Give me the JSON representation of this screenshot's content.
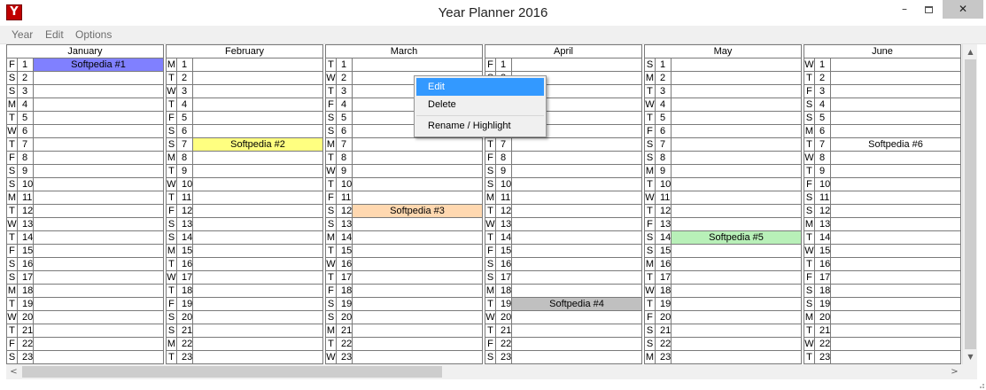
{
  "window": {
    "title": "Year Planner 2016",
    "app_icon_glyph": "Y",
    "minimize_glyph": "–",
    "close_glyph": "✕"
  },
  "menubar": {
    "items": [
      "Year",
      "Edit",
      "Options"
    ]
  },
  "months": [
    {
      "name": "January",
      "days": [
        [
          "F",
          "1"
        ],
        [
          "S",
          "2"
        ],
        [
          "S",
          "3"
        ],
        [
          "M",
          "4"
        ],
        [
          "T",
          "5"
        ],
        [
          "W",
          "6"
        ],
        [
          "T",
          "7"
        ],
        [
          "F",
          "8"
        ],
        [
          "S",
          "9"
        ],
        [
          "S",
          "10"
        ],
        [
          "M",
          "11"
        ],
        [
          "T",
          "12"
        ],
        [
          "W",
          "13"
        ],
        [
          "T",
          "14"
        ],
        [
          "F",
          "15"
        ],
        [
          "S",
          "16"
        ],
        [
          "S",
          "17"
        ],
        [
          "M",
          "18"
        ],
        [
          "T",
          "19"
        ],
        [
          "W",
          "20"
        ],
        [
          "T",
          "21"
        ],
        [
          "F",
          "22"
        ],
        [
          "S",
          "23"
        ]
      ],
      "events": [
        {
          "day": 1,
          "label": "Softpedia #1",
          "color": "#8080ff"
        }
      ]
    },
    {
      "name": "February",
      "days": [
        [
          "M",
          "1"
        ],
        [
          "T",
          "2"
        ],
        [
          "W",
          "3"
        ],
        [
          "T",
          "4"
        ],
        [
          "F",
          "5"
        ],
        [
          "S",
          "6"
        ],
        [
          "S",
          "7"
        ],
        [
          "M",
          "8"
        ],
        [
          "T",
          "9"
        ],
        [
          "W",
          "10"
        ],
        [
          "T",
          "11"
        ],
        [
          "F",
          "12"
        ],
        [
          "S",
          "13"
        ],
        [
          "S",
          "14"
        ],
        [
          "M",
          "15"
        ],
        [
          "T",
          "16"
        ],
        [
          "W",
          "17"
        ],
        [
          "T",
          "18"
        ],
        [
          "F",
          "19"
        ],
        [
          "S",
          "20"
        ],
        [
          "S",
          "21"
        ],
        [
          "M",
          "22"
        ],
        [
          "T",
          "23"
        ]
      ],
      "events": [
        {
          "day": 7,
          "label": "Softpedia #2",
          "color": "#ffff80"
        }
      ]
    },
    {
      "name": "March",
      "days": [
        [
          "T",
          "1"
        ],
        [
          "W",
          "2"
        ],
        [
          "T",
          "3"
        ],
        [
          "F",
          "4"
        ],
        [
          "S",
          "5"
        ],
        [
          "S",
          "6"
        ],
        [
          "M",
          "7"
        ],
        [
          "T",
          "8"
        ],
        [
          "W",
          "9"
        ],
        [
          "T",
          "10"
        ],
        [
          "F",
          "11"
        ],
        [
          "S",
          "12"
        ],
        [
          "S",
          "13"
        ],
        [
          "M",
          "14"
        ],
        [
          "T",
          "15"
        ],
        [
          "W",
          "16"
        ],
        [
          "T",
          "17"
        ],
        [
          "F",
          "18"
        ],
        [
          "S",
          "19"
        ],
        [
          "S",
          "20"
        ],
        [
          "M",
          "21"
        ],
        [
          "T",
          "22"
        ],
        [
          "W",
          "23"
        ]
      ],
      "events": [
        {
          "day": 12,
          "label": "Softpedia #3",
          "color": "#ffd8b0"
        }
      ]
    },
    {
      "name": "April",
      "days": [
        [
          "F",
          "1"
        ],
        [
          "S",
          "2"
        ],
        [
          "S",
          "3"
        ],
        [
          "M",
          "4"
        ],
        [
          "T",
          "5"
        ],
        [
          "W",
          "6"
        ],
        [
          "T",
          "7"
        ],
        [
          "F",
          "8"
        ],
        [
          "S",
          "9"
        ],
        [
          "S",
          "10"
        ],
        [
          "M",
          "11"
        ],
        [
          "T",
          "12"
        ],
        [
          "W",
          "13"
        ],
        [
          "T",
          "14"
        ],
        [
          "F",
          "15"
        ],
        [
          "S",
          "16"
        ],
        [
          "S",
          "17"
        ],
        [
          "M",
          "18"
        ],
        [
          "T",
          "19"
        ],
        [
          "W",
          "20"
        ],
        [
          "T",
          "21"
        ],
        [
          "F",
          "22"
        ],
        [
          "S",
          "23"
        ]
      ],
      "events": [
        {
          "day": 19,
          "label": "Softpedia #4",
          "color": "#c0c0c0"
        }
      ]
    },
    {
      "name": "May",
      "days": [
        [
          "S",
          "1"
        ],
        [
          "M",
          "2"
        ],
        [
          "T",
          "3"
        ],
        [
          "W",
          "4"
        ],
        [
          "T",
          "5"
        ],
        [
          "F",
          "6"
        ],
        [
          "S",
          "7"
        ],
        [
          "S",
          "8"
        ],
        [
          "M",
          "9"
        ],
        [
          "T",
          "10"
        ],
        [
          "W",
          "11"
        ],
        [
          "T",
          "12"
        ],
        [
          "F",
          "13"
        ],
        [
          "S",
          "14"
        ],
        [
          "S",
          "15"
        ],
        [
          "M",
          "16"
        ],
        [
          "T",
          "17"
        ],
        [
          "W",
          "18"
        ],
        [
          "T",
          "19"
        ],
        [
          "F",
          "20"
        ],
        [
          "S",
          "21"
        ],
        [
          "S",
          "22"
        ],
        [
          "M",
          "23"
        ]
      ],
      "events": [
        {
          "day": 14,
          "label": "Softpedia #5",
          "color": "#b8f0b8"
        }
      ]
    },
    {
      "name": "June",
      "days": [
        [
          "W",
          "1"
        ],
        [
          "T",
          "2"
        ],
        [
          "F",
          "3"
        ],
        [
          "S",
          "4"
        ],
        [
          "S",
          "5"
        ],
        [
          "M",
          "6"
        ],
        [
          "T",
          "7"
        ],
        [
          "W",
          "8"
        ],
        [
          "T",
          "9"
        ],
        [
          "F",
          "10"
        ],
        [
          "S",
          "11"
        ],
        [
          "S",
          "12"
        ],
        [
          "M",
          "13"
        ],
        [
          "T",
          "14"
        ],
        [
          "W",
          "15"
        ],
        [
          "T",
          "16"
        ],
        [
          "F",
          "17"
        ],
        [
          "S",
          "18"
        ],
        [
          "S",
          "19"
        ],
        [
          "M",
          "20"
        ],
        [
          "T",
          "21"
        ],
        [
          "W",
          "22"
        ],
        [
          "T",
          "23"
        ]
      ],
      "events": [
        {
          "day": 7,
          "label": "Softpedia #6",
          "color": "#ffffff"
        }
      ]
    }
  ],
  "context_menu": {
    "items": [
      {
        "label": "Edit",
        "selected": true
      },
      {
        "label": "Delete",
        "selected": false
      },
      {
        "label": "Rename / Highlight",
        "selected": false
      }
    ]
  },
  "scrollbars": {
    "up_glyph": "▲",
    "down_glyph": "▼",
    "left_glyph": "<",
    "right_glyph": ">",
    "horizontal_position": 0.43,
    "vertical_position": 0.91
  }
}
